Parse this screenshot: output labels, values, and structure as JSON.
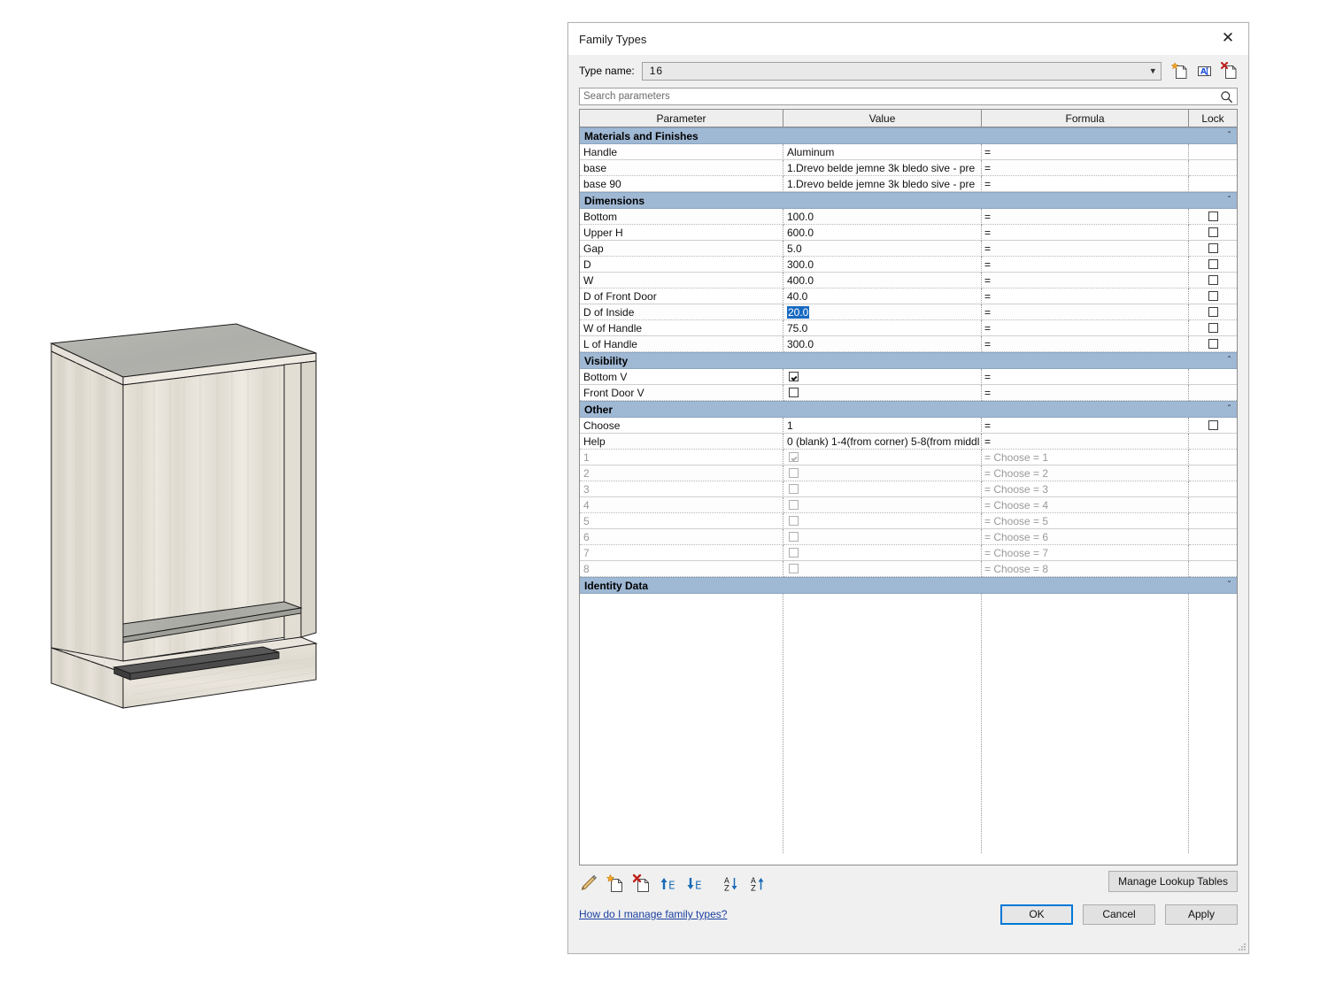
{
  "window": {
    "title": "Family Types",
    "close_label": "✕"
  },
  "type_name": {
    "label": "Type name:",
    "value": "16",
    "dropdown_icon": "chevron-down-icon",
    "actions": [
      {
        "name": "new-type-icon",
        "tooltip": "New Type"
      },
      {
        "name": "rename-type-icon",
        "tooltip": "Rename"
      },
      {
        "name": "delete-type-icon",
        "tooltip": "Delete"
      }
    ]
  },
  "search": {
    "placeholder": "Search parameters",
    "icon": "search-icon"
  },
  "columns": [
    "Parameter",
    "Value",
    "Formula",
    "Lock"
  ],
  "sections": [
    {
      "name": "Materials and Finishes",
      "collapsed": false,
      "rows": [
        {
          "parameter": "Handle",
          "value": "Aluminum",
          "formula": "=",
          "lock": null
        },
        {
          "parameter": "base",
          "value": "1.Drevo belde jemne 3k bledo sive - pre",
          "formula": "=",
          "lock": null
        },
        {
          "parameter": "base 90",
          "value": "1.Drevo belde jemne 3k bledo sive - pre",
          "formula": "=",
          "lock": null
        }
      ]
    },
    {
      "name": "Dimensions",
      "collapsed": false,
      "rows": [
        {
          "parameter": "Bottom",
          "value": "100.0",
          "formula": "=",
          "lock": "unchecked"
        },
        {
          "parameter": "Upper H",
          "value": "600.0",
          "formula": "=",
          "lock": "unchecked"
        },
        {
          "parameter": "Gap",
          "value": "5.0",
          "formula": "=",
          "lock": "unchecked"
        },
        {
          "parameter": "D",
          "value": "300.0",
          "formula": "=",
          "lock": "unchecked"
        },
        {
          "parameter": "W",
          "value": "400.0",
          "formula": "=",
          "lock": "unchecked"
        },
        {
          "parameter": "D of Front Door",
          "value": "40.0",
          "formula": "=",
          "lock": "unchecked"
        },
        {
          "parameter": "D of Inside",
          "value": "20.0",
          "formula": "=",
          "lock": "unchecked",
          "selected": true
        },
        {
          "parameter": "W of Handle",
          "value": "75.0",
          "formula": "=",
          "lock": "unchecked"
        },
        {
          "parameter": "L of Handle",
          "value": "300.0",
          "formula": "=",
          "lock": "unchecked"
        }
      ]
    },
    {
      "name": "Visibility",
      "collapsed": false,
      "rows": [
        {
          "parameter": "Bottom V",
          "value_checkbox": "checked",
          "formula": "=",
          "lock": null
        },
        {
          "parameter": "Front Door V",
          "value_checkbox": "unchecked",
          "formula": "=",
          "lock": null
        }
      ]
    },
    {
      "name": "Other",
      "collapsed": false,
      "rows": [
        {
          "parameter": "Choose",
          "value": "1",
          "formula": "=",
          "lock": "unchecked"
        },
        {
          "parameter": "Help",
          "value": "0 (blank) 1-4(from corner) 5-8(from middl",
          "formula": "=",
          "lock": null
        },
        {
          "parameter": "1",
          "value_checkbox": "checked",
          "formula": "= Choose = 1",
          "lock": null,
          "disabled": true
        },
        {
          "parameter": "2",
          "value_checkbox": "unchecked",
          "formula": "= Choose = 2",
          "lock": null,
          "disabled": true
        },
        {
          "parameter": "3",
          "value_checkbox": "unchecked",
          "formula": "= Choose = 3",
          "lock": null,
          "disabled": true
        },
        {
          "parameter": "4",
          "value_checkbox": "unchecked",
          "formula": "= Choose = 4",
          "lock": null,
          "disabled": true
        },
        {
          "parameter": "5",
          "value_checkbox": "unchecked",
          "formula": "= Choose = 5",
          "lock": null,
          "disabled": true
        },
        {
          "parameter": "6",
          "value_checkbox": "unchecked",
          "formula": "= Choose = 6",
          "lock": null,
          "disabled": true
        },
        {
          "parameter": "7",
          "value_checkbox": "unchecked",
          "formula": "= Choose = 7",
          "lock": null,
          "disabled": true
        },
        {
          "parameter": "8",
          "value_checkbox": "unchecked",
          "formula": "= Choose = 8",
          "lock": null,
          "disabled": true
        }
      ]
    },
    {
      "name": "Identity Data",
      "collapsed": true,
      "rows": []
    }
  ],
  "toolbar": {
    "icons": [
      {
        "name": "edit-pencil-icon",
        "tooltip": "Edit"
      },
      {
        "name": "new-parameter-icon",
        "tooltip": "New Parameter"
      },
      {
        "name": "delete-parameter-icon",
        "tooltip": "Remove Parameter"
      },
      {
        "name": "move-up-icon",
        "tooltip": "Move Up"
      },
      {
        "name": "move-down-icon",
        "tooltip": "Move Down"
      },
      {
        "name": "sort-descending-icon",
        "tooltip": "Sort Descending"
      },
      {
        "name": "sort-ascending-icon",
        "tooltip": "Sort Ascending"
      }
    ],
    "manage_lookup_tables_label": "Manage Lookup Tables"
  },
  "footer": {
    "help_link": "How do I manage family types?",
    "ok_label": "OK",
    "cancel_label": "Cancel",
    "apply_label": "Apply"
  },
  "colors": {
    "section_header": "#9fb8d4",
    "selection": "#1669c1",
    "focus_border": "#0078d7",
    "link": "#1b3fa0",
    "dialog_bg": "#f0f0f0"
  }
}
